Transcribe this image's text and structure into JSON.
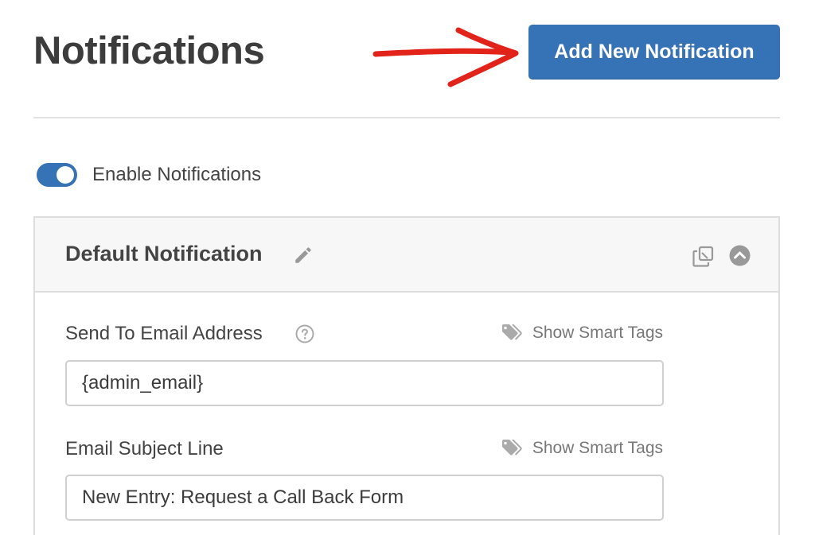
{
  "header": {
    "title": "Notifications",
    "add_button_label": "Add New Notification"
  },
  "toggle": {
    "label": "Enable Notifications",
    "enabled": true
  },
  "notification_panel": {
    "title": "Default Notification",
    "fields": [
      {
        "label": "Send To Email Address",
        "value": "{admin_email}",
        "smart_tags_label": "Show Smart Tags",
        "has_help": true
      },
      {
        "label": "Email Subject Line",
        "value": "New Entry: Request a Call Back Form",
        "smart_tags_label": "Show Smart Tags",
        "has_help": false
      }
    ]
  },
  "icons": {
    "edit": "pencil-icon",
    "clone": "clone-icon",
    "collapse": "chevron-up-circle-icon",
    "help": "question-circle-icon",
    "tag": "tag-icon",
    "annotation": "red-arrow-icon"
  },
  "colors": {
    "primary": "#3672b6",
    "annotation_arrow": "#e2231a",
    "panel_header_bg": "#f7f7f7",
    "muted_text": "#777777"
  }
}
